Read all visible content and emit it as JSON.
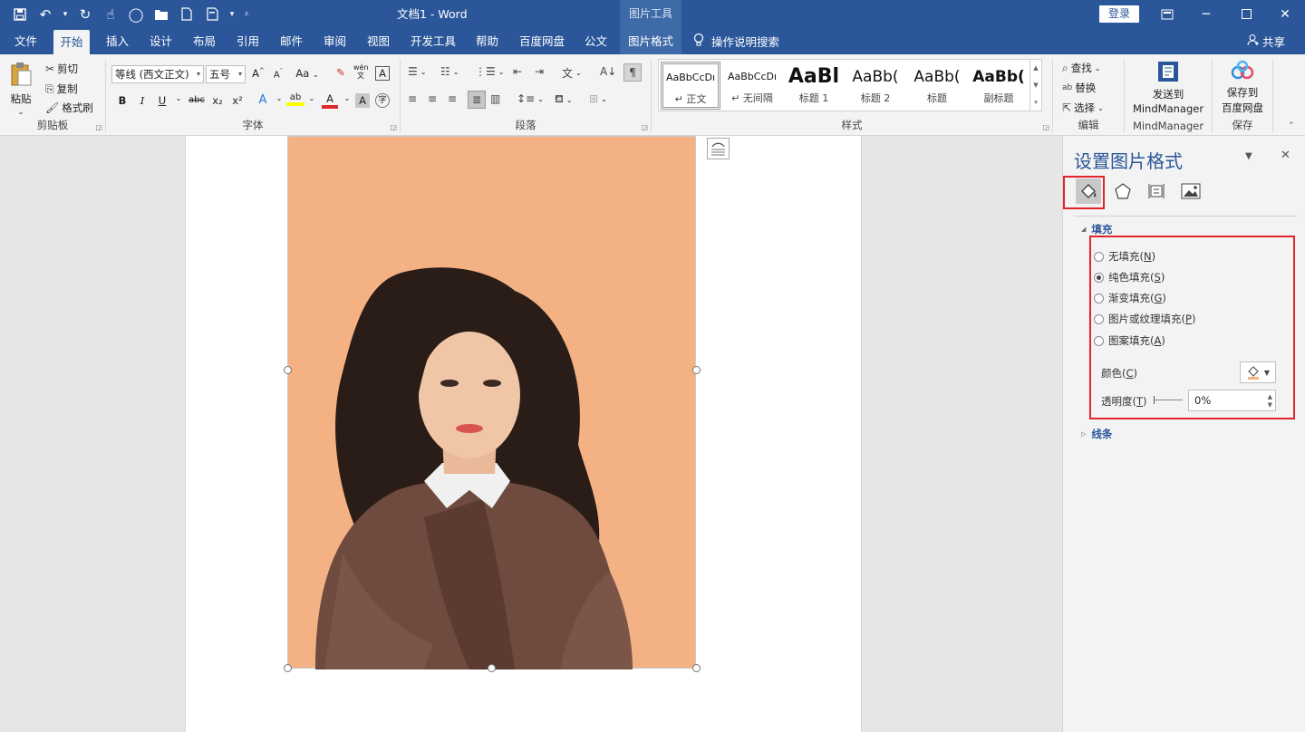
{
  "titlebar": {
    "doc_title": "文档1  -  Word",
    "context_group": "图片工具",
    "login": "登录",
    "qat_icons": [
      "save-icon",
      "undo-icon",
      "redo-icon",
      "touch-mode-icon",
      "shape-icon",
      "open-folder-icon",
      "new-doc-icon",
      "print-icon",
      "customize-qat-icon"
    ],
    "window_controls": [
      "ribbon-display-icon",
      "minimize-icon",
      "maximize-icon",
      "close-icon"
    ]
  },
  "tabs": [
    {
      "label": "文件"
    },
    {
      "label": "开始"
    },
    {
      "label": "插入"
    },
    {
      "label": "设计"
    },
    {
      "label": "布局"
    },
    {
      "label": "引用"
    },
    {
      "label": "邮件"
    },
    {
      "label": "审阅"
    },
    {
      "label": "视图"
    },
    {
      "label": "开发工具"
    },
    {
      "label": "帮助"
    },
    {
      "label": "百度网盘"
    },
    {
      "label": "公文"
    },
    {
      "label": "图片格式"
    }
  ],
  "tellme": "操作说明搜索",
  "share": "共享",
  "ribbon": {
    "clipboard": {
      "label": "剪贴板",
      "paste": "粘贴",
      "cut": "剪切",
      "copy": "复制",
      "format_painter": "格式刷"
    },
    "font": {
      "label": "字体",
      "font_name": "等线 (西文正文)",
      "font_size": "五号",
      "grow": "A",
      "shrink": "A",
      "change_case": "Aa",
      "phonetic": "wén",
      "border_char": "A",
      "bold": "B",
      "italic": "I",
      "underline": "U",
      "strike": "abc",
      "subscript": "x₂",
      "superscript": "x²",
      "effects": "A",
      "highlight": "ab",
      "font_color": "A",
      "char_shading": "A",
      "enclose": "字"
    },
    "paragraph": {
      "label": "段落"
    },
    "styles": {
      "label": "样式",
      "items": [
        {
          "preview": "AaBbCcDı",
          "name": "↵ 正文"
        },
        {
          "preview": "AaBbCcDı",
          "name": "↵ 无间隔"
        },
        {
          "preview": "AaBl",
          "name": "标题 1"
        },
        {
          "preview": "AaBb(",
          "name": "标题 2"
        },
        {
          "preview": "AaBb(",
          "name": "标题"
        },
        {
          "preview": "AaBb(",
          "name": "副标题"
        }
      ]
    },
    "editing": {
      "label": "编辑",
      "find": "查找",
      "replace": "替换",
      "select": "选择"
    },
    "mindmanager": {
      "label": "MindManager",
      "send_line1": "发送到",
      "send_line2": "MindManager"
    },
    "save": {
      "label": "保存",
      "line1": "保存到",
      "line2": "百度网盘"
    }
  },
  "pane": {
    "title": "设置图片格式",
    "tabs": [
      "fill-line-icon",
      "effects-icon",
      "layout-properties-icon",
      "picture-icon"
    ],
    "fill_section": "填充",
    "fill_options": [
      {
        "label": "无填充",
        "key": "N",
        "checked": false
      },
      {
        "label": "纯色填充",
        "key": "S",
        "checked": true
      },
      {
        "label": "渐变填充",
        "key": "G",
        "checked": false
      },
      {
        "label": "图片或纹理填充",
        "key": "P",
        "checked": false
      },
      {
        "label": "图案填充",
        "key": "A",
        "checked": false
      }
    ],
    "color_label": "颜色",
    "color_key": "C",
    "color_value": "#f4b183",
    "transparency_label": "透明度",
    "transparency_key": "T",
    "transparency_value": "0%",
    "line_section": "线条"
  },
  "picture": {
    "fill_color": "#f4b183"
  }
}
